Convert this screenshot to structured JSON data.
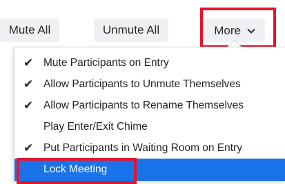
{
  "toolbar": {
    "mute_all": "Mute All",
    "unmute_all": "Unmute All",
    "more": "More"
  },
  "menu": {
    "items": [
      {
        "label": "Mute Participants on Entry",
        "checked": true
      },
      {
        "label": "Allow Participants to Unmute Themselves",
        "checked": true
      },
      {
        "label": "Allow Participants to Rename Themselves",
        "checked": true
      },
      {
        "label": "Play Enter/Exit Chime",
        "checked": false
      },
      {
        "label": "Put Participants in Waiting Room on Entry",
        "checked": true
      },
      {
        "label": "Lock Meeting",
        "checked": false,
        "selected": true
      }
    ],
    "check_glyph": "✔",
    "selected_color": "#1a73e8"
  },
  "annotations": {
    "highlight_color": "#e3152b"
  }
}
